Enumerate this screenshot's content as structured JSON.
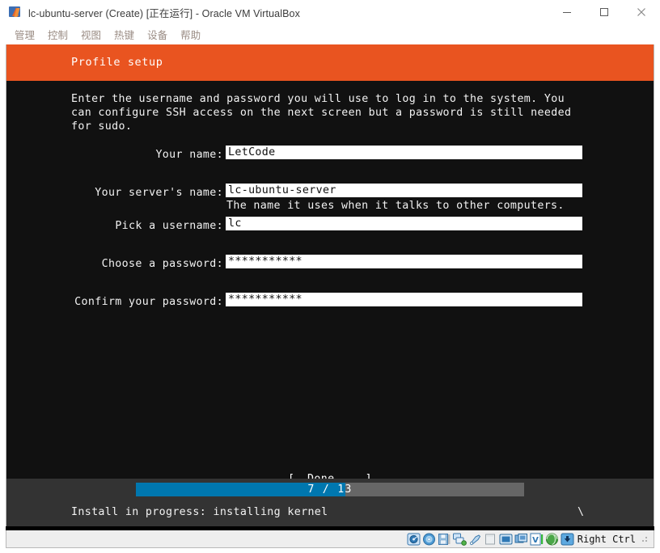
{
  "window": {
    "title": "lc-ubuntu-server (Create) [正在运行] - Oracle VM VirtualBox",
    "logo_icon": "virtualbox-logo-icon",
    "controls": [
      {
        "name": "minimize-button",
        "label": "—",
        "icon": "minimize-icon"
      },
      {
        "name": "maximize-button",
        "label": "□",
        "icon": "maximize-icon"
      },
      {
        "name": "close-button",
        "label": "✕",
        "icon": "close-icon"
      }
    ]
  },
  "menubar": {
    "items": [
      {
        "label": "管理"
      },
      {
        "label": "控制"
      },
      {
        "label": "视图"
      },
      {
        "label": "热键"
      },
      {
        "label": "设备"
      },
      {
        "label": "帮助"
      }
    ]
  },
  "installer": {
    "header_title": "Profile setup",
    "header_color": "#e95420",
    "intro": "Enter the username and password you will use to log in to the system. You can configure SSH access on the next screen but a password is still needed for sudo.",
    "fields": [
      {
        "label": "Your name:",
        "value": "LetCode",
        "placeholder": "",
        "hint": "",
        "name": "your-name-input"
      },
      {
        "label": "Your server's name:",
        "value": "lc-ubuntu-server",
        "placeholder": "",
        "hint": "The name it uses when it talks to other computers.",
        "name": "server-name-input"
      },
      {
        "label": "Pick a username:",
        "value": "lc",
        "placeholder": "",
        "hint": "",
        "name": "username-input"
      },
      {
        "label": "Choose a password:",
        "value": "***********",
        "placeholder": "",
        "hint": "",
        "name": "password-input"
      },
      {
        "label": "Confirm your password:",
        "value": "***********",
        "placeholder": "",
        "hint": "",
        "name": "confirm-password-input"
      }
    ],
    "done_button": {
      "left_bracket": "[",
      "label": "Done",
      "right_bracket": "]",
      "background": "#0f7a1e"
    },
    "progress": {
      "current": 7,
      "total": 13,
      "text": "7 / 13",
      "percent": 54,
      "fill_color": "#0077af",
      "track_color": "#666666"
    },
    "status_line": "Install in progress: installing kernel",
    "spinner": "\\"
  },
  "statusbar": {
    "icons": [
      {
        "name": "hard-disk-icon",
        "title": "hard-disk"
      },
      {
        "name": "optical-disk-icon",
        "title": "optical-disk"
      },
      {
        "name": "floppy-disk-icon",
        "title": "floppy-disk"
      },
      {
        "name": "network-icon",
        "title": "network"
      },
      {
        "name": "usb-icon",
        "title": "usb"
      },
      {
        "name": "shared-folders-icon",
        "title": "shared-folders"
      },
      {
        "name": "display-icon",
        "title": "display"
      },
      {
        "name": "remote-desktop-icon",
        "title": "remote-desktop"
      },
      {
        "name": "video-capture-icon",
        "title": "video-capture"
      },
      {
        "name": "mouse-integration-icon",
        "title": "mouse-integration"
      },
      {
        "name": "host-key-icon",
        "title": "host-key"
      }
    ],
    "host_key": "Right Ctrl"
  }
}
